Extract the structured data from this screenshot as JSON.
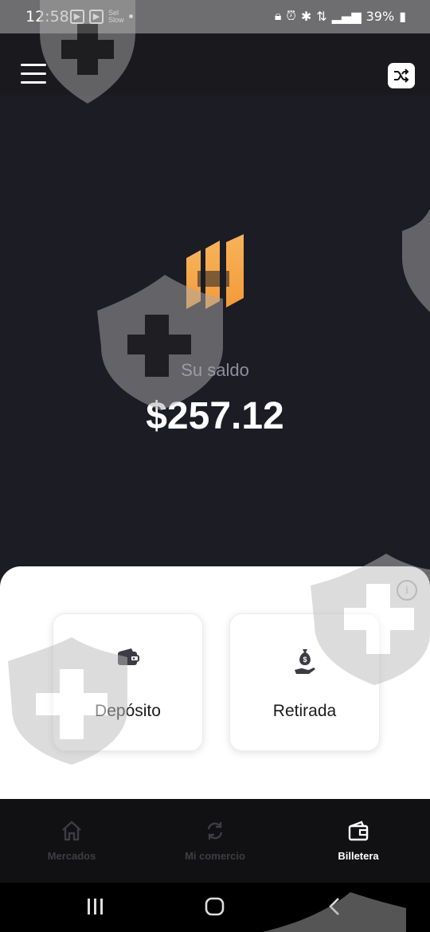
{
  "status_bar": {
    "time": "12:58",
    "battery": "39%",
    "left_icons": [
      "play-box-icon",
      "play-box-icon",
      "tiny-text-icon",
      "dot-icon"
    ],
    "right_icons": [
      "lock-icon",
      "alarm-icon",
      "bluetooth-icon",
      "data-arrows-icon",
      "signal-icon",
      "battery-icon"
    ],
    "tiny_text": "Sel\nSlow"
  },
  "header": {
    "menu_icon": "hamburger-icon",
    "action_icon": "shuffle-icon"
  },
  "hero": {
    "logo_icon": "brand-logo-bars",
    "balance_label": "Su saldo",
    "balance_value": "$257.12"
  },
  "actions": {
    "info_icon": "i",
    "deposit": {
      "label": "Depósito",
      "icon": "wallet-icon"
    },
    "withdraw": {
      "label": "Retirada",
      "icon": "money-bag-hand-icon"
    }
  },
  "tabs": [
    {
      "label": "Mercados",
      "icon": "home-icon",
      "active": false
    },
    {
      "label": "Mi comercio",
      "icon": "refresh-icon",
      "active": false
    },
    {
      "label": "Billetera",
      "icon": "wallet-icon",
      "active": true
    }
  ],
  "colors": {
    "background": "#1c1c25",
    "logo_orange": "#f5a040",
    "sheet": "#ffffff",
    "tabbar": "#111113",
    "active_tab": "#ffffff",
    "inactive_tab": "#3d3d44"
  }
}
